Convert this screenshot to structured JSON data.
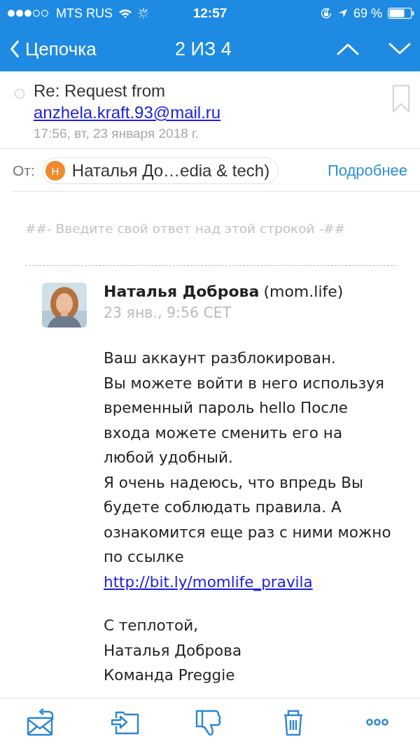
{
  "status_bar": {
    "carrier": "MTS RUS",
    "time": "12:57",
    "battery": "69 %"
  },
  "nav": {
    "back": "Цепочка",
    "position": "2 ИЗ 4"
  },
  "message": {
    "subject": "Re: Request from ",
    "subject_link": "anzhela.kraft.93@mail.ru",
    "date": "17:56, вт, 23 января 2018 г.",
    "from_label": "От:",
    "sender_initial": "Н",
    "sender": "Наталья До…edia & tech)",
    "details": "Подробнее"
  },
  "reply_marker": "##- Введите свой ответ над этой строкой -##",
  "post": {
    "author": "Наталья Доброва",
    "org": "(mom.life)",
    "date": "23 янв., 9:56 CET",
    "paragraphs": [
      "Ваш аккаунт разблокирован.",
      "Вы можете войти в него используя временный пароль hello После входа можете сменить его на любой удобный.",
      "Я очень надеюсь, что впредь Вы будете соблюдать правила. А ознакомится еще раз с ними можно по ссылке"
    ],
    "link": "http://bit.ly/momlife_pravila",
    "signature": [
      "С теплотой,",
      "Наталья Доброва",
      "Команда Preggie"
    ]
  }
}
